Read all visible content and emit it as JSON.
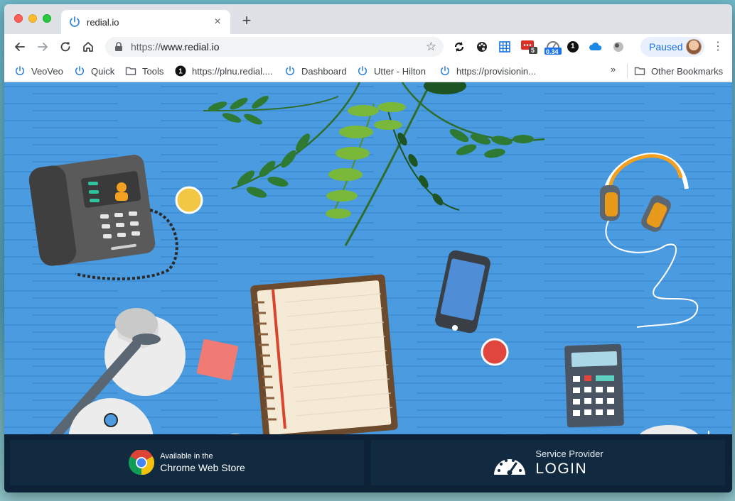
{
  "browser": {
    "tab": {
      "title": "redial.io",
      "close_glyph": "×",
      "favicon": "power-icon"
    },
    "new_tab_glyph": "+",
    "nav": {
      "back": "back-icon",
      "forward": "forward-icon",
      "reload": "reload-icon",
      "home": "home-icon"
    },
    "address": {
      "scheme": "https://",
      "host": "www.redial.io"
    },
    "extensions": {
      "badge_red": "5",
      "badge_blue": "0.34",
      "badge_black": "1"
    },
    "profile": {
      "label": "Paused"
    },
    "menu_glyph": "⋮"
  },
  "bookmarks": {
    "items": [
      {
        "label": "VeoVeo",
        "icon": "power-icon"
      },
      {
        "label": "Quick",
        "icon": "power-icon"
      },
      {
        "label": "Tools",
        "icon": "folder-icon"
      },
      {
        "label": "https://plnu.redial....",
        "icon": "number-one-icon"
      },
      {
        "label": "Dashboard",
        "icon": "power-icon"
      },
      {
        "label": "Utter - Hilton",
        "icon": "power-icon"
      },
      {
        "label": "https://provisionin...",
        "icon": "power-icon"
      }
    ],
    "overflow_glyph": "»",
    "other": {
      "label": "Other Bookmarks",
      "icon": "folder-icon"
    }
  },
  "page": {
    "chrome_store": {
      "line1": "Available in the",
      "line2": "Chrome Web Store"
    },
    "login": {
      "line1": "Service Provider",
      "line2": "LOGIN"
    }
  },
  "colors": {
    "hero_blue": "#4a9be0",
    "bar_dark": "#0d2236",
    "panel": "#122a40",
    "accent_red": "#e0463d",
    "accent_yellow": "#f2c744"
  }
}
